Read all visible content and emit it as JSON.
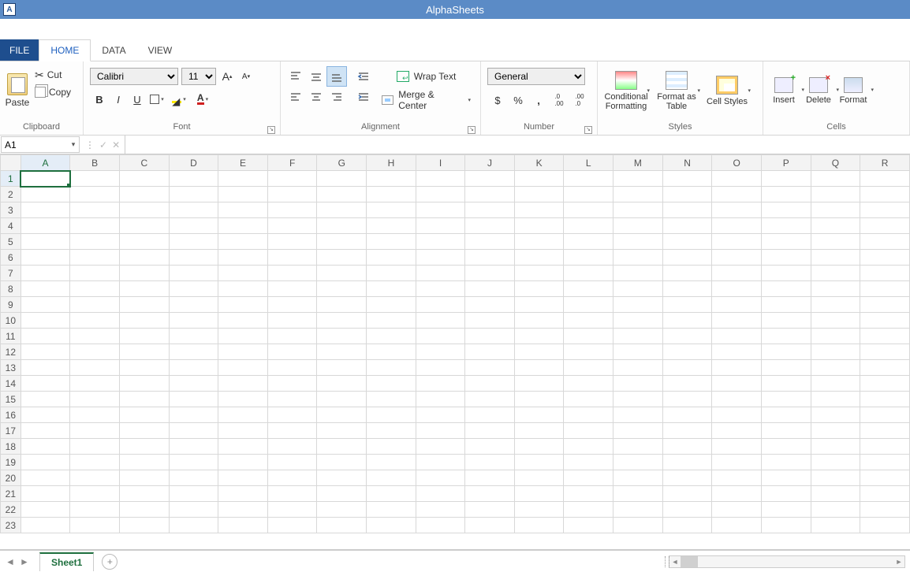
{
  "app": {
    "title": "AlphaSheets",
    "icon_letter": "A"
  },
  "tabs": {
    "file": "FILE",
    "home": "HOME",
    "data": "DATA",
    "view": "VIEW",
    "active": "home"
  },
  "clipboard": {
    "paste": "Paste",
    "cut": "Cut",
    "copy": "Copy",
    "group": "Clipboard"
  },
  "font": {
    "name": "Calibri",
    "size": "11",
    "grow": "A",
    "shrink": "A",
    "bold": "B",
    "italic": "I",
    "underline": "U",
    "group": "Font"
  },
  "alignment": {
    "wrap": "Wrap Text",
    "merge": "Merge & Center",
    "group": "Alignment"
  },
  "number": {
    "format": "General",
    "group": "Number",
    "currency": "$",
    "percent": "%",
    "comma": ",",
    "inc": ".00→.0",
    "dec": ".0→.00"
  },
  "styles": {
    "cond": "Conditional Formatting",
    "tbl": "Format as Table",
    "cell": "Cell Styles",
    "group": "Styles"
  },
  "cells": {
    "insert": "Insert",
    "delete": "Delete",
    "format": "Format",
    "group": "Cells"
  },
  "formula": {
    "namebox": "A1",
    "value": ""
  },
  "grid": {
    "cols": [
      "A",
      "B",
      "C",
      "D",
      "E",
      "F",
      "G",
      "H",
      "I",
      "J",
      "K",
      "L",
      "M",
      "N",
      "O",
      "P",
      "Q",
      "R"
    ],
    "rows": [
      1,
      2,
      3,
      4,
      5,
      6,
      7,
      8,
      9,
      10,
      11,
      12,
      13,
      14,
      15,
      16,
      17,
      18,
      19,
      20,
      21,
      22,
      23
    ],
    "selected": {
      "row": 1,
      "col": "A"
    }
  },
  "sheets": {
    "active": "Sheet1"
  }
}
